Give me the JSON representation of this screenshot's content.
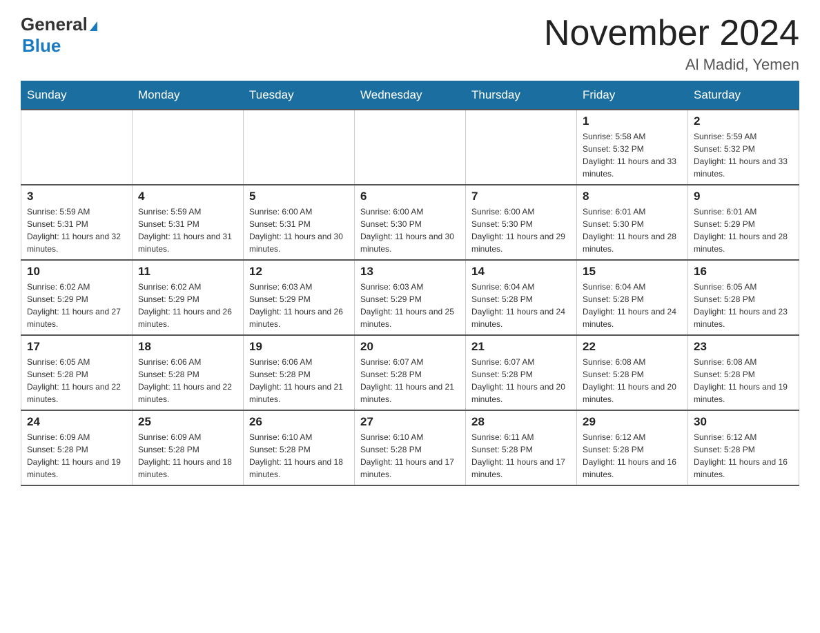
{
  "header": {
    "logo_general": "General",
    "logo_blue": "Blue",
    "title": "November 2024",
    "subtitle": "Al Madid, Yemen"
  },
  "days_of_week": [
    "Sunday",
    "Monday",
    "Tuesday",
    "Wednesday",
    "Thursday",
    "Friday",
    "Saturday"
  ],
  "weeks": [
    [
      {
        "day": "",
        "info": ""
      },
      {
        "day": "",
        "info": ""
      },
      {
        "day": "",
        "info": ""
      },
      {
        "day": "",
        "info": ""
      },
      {
        "day": "",
        "info": ""
      },
      {
        "day": "1",
        "info": "Sunrise: 5:58 AM\nSunset: 5:32 PM\nDaylight: 11 hours and 33 minutes."
      },
      {
        "day": "2",
        "info": "Sunrise: 5:59 AM\nSunset: 5:32 PM\nDaylight: 11 hours and 33 minutes."
      }
    ],
    [
      {
        "day": "3",
        "info": "Sunrise: 5:59 AM\nSunset: 5:31 PM\nDaylight: 11 hours and 32 minutes."
      },
      {
        "day": "4",
        "info": "Sunrise: 5:59 AM\nSunset: 5:31 PM\nDaylight: 11 hours and 31 minutes."
      },
      {
        "day": "5",
        "info": "Sunrise: 6:00 AM\nSunset: 5:31 PM\nDaylight: 11 hours and 30 minutes."
      },
      {
        "day": "6",
        "info": "Sunrise: 6:00 AM\nSunset: 5:30 PM\nDaylight: 11 hours and 30 minutes."
      },
      {
        "day": "7",
        "info": "Sunrise: 6:00 AM\nSunset: 5:30 PM\nDaylight: 11 hours and 29 minutes."
      },
      {
        "day": "8",
        "info": "Sunrise: 6:01 AM\nSunset: 5:30 PM\nDaylight: 11 hours and 28 minutes."
      },
      {
        "day": "9",
        "info": "Sunrise: 6:01 AM\nSunset: 5:29 PM\nDaylight: 11 hours and 28 minutes."
      }
    ],
    [
      {
        "day": "10",
        "info": "Sunrise: 6:02 AM\nSunset: 5:29 PM\nDaylight: 11 hours and 27 minutes."
      },
      {
        "day": "11",
        "info": "Sunrise: 6:02 AM\nSunset: 5:29 PM\nDaylight: 11 hours and 26 minutes."
      },
      {
        "day": "12",
        "info": "Sunrise: 6:03 AM\nSunset: 5:29 PM\nDaylight: 11 hours and 26 minutes."
      },
      {
        "day": "13",
        "info": "Sunrise: 6:03 AM\nSunset: 5:29 PM\nDaylight: 11 hours and 25 minutes."
      },
      {
        "day": "14",
        "info": "Sunrise: 6:04 AM\nSunset: 5:28 PM\nDaylight: 11 hours and 24 minutes."
      },
      {
        "day": "15",
        "info": "Sunrise: 6:04 AM\nSunset: 5:28 PM\nDaylight: 11 hours and 24 minutes."
      },
      {
        "day": "16",
        "info": "Sunrise: 6:05 AM\nSunset: 5:28 PM\nDaylight: 11 hours and 23 minutes."
      }
    ],
    [
      {
        "day": "17",
        "info": "Sunrise: 6:05 AM\nSunset: 5:28 PM\nDaylight: 11 hours and 22 minutes."
      },
      {
        "day": "18",
        "info": "Sunrise: 6:06 AM\nSunset: 5:28 PM\nDaylight: 11 hours and 22 minutes."
      },
      {
        "day": "19",
        "info": "Sunrise: 6:06 AM\nSunset: 5:28 PM\nDaylight: 11 hours and 21 minutes."
      },
      {
        "day": "20",
        "info": "Sunrise: 6:07 AM\nSunset: 5:28 PM\nDaylight: 11 hours and 21 minutes."
      },
      {
        "day": "21",
        "info": "Sunrise: 6:07 AM\nSunset: 5:28 PM\nDaylight: 11 hours and 20 minutes."
      },
      {
        "day": "22",
        "info": "Sunrise: 6:08 AM\nSunset: 5:28 PM\nDaylight: 11 hours and 20 minutes."
      },
      {
        "day": "23",
        "info": "Sunrise: 6:08 AM\nSunset: 5:28 PM\nDaylight: 11 hours and 19 minutes."
      }
    ],
    [
      {
        "day": "24",
        "info": "Sunrise: 6:09 AM\nSunset: 5:28 PM\nDaylight: 11 hours and 19 minutes."
      },
      {
        "day": "25",
        "info": "Sunrise: 6:09 AM\nSunset: 5:28 PM\nDaylight: 11 hours and 18 minutes."
      },
      {
        "day": "26",
        "info": "Sunrise: 6:10 AM\nSunset: 5:28 PM\nDaylight: 11 hours and 18 minutes."
      },
      {
        "day": "27",
        "info": "Sunrise: 6:10 AM\nSunset: 5:28 PM\nDaylight: 11 hours and 17 minutes."
      },
      {
        "day": "28",
        "info": "Sunrise: 6:11 AM\nSunset: 5:28 PM\nDaylight: 11 hours and 17 minutes."
      },
      {
        "day": "29",
        "info": "Sunrise: 6:12 AM\nSunset: 5:28 PM\nDaylight: 11 hours and 16 minutes."
      },
      {
        "day": "30",
        "info": "Sunrise: 6:12 AM\nSunset: 5:28 PM\nDaylight: 11 hours and 16 minutes."
      }
    ]
  ]
}
